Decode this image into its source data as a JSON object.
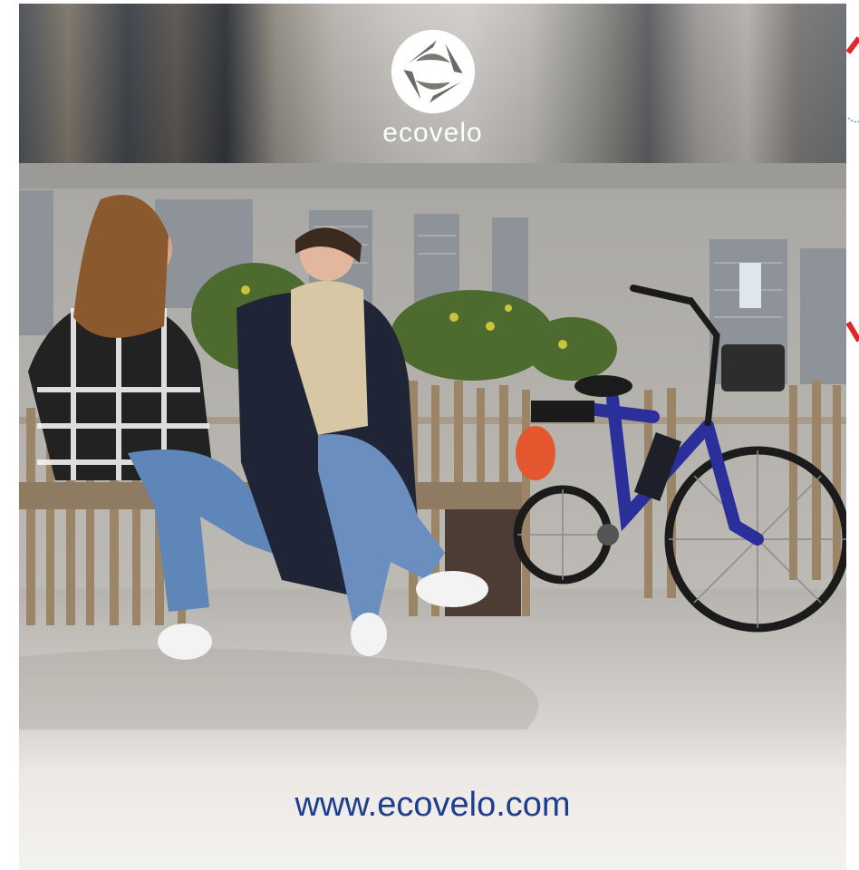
{
  "brand": {
    "name": "ecovelo",
    "website": "www.ecovelo.com"
  },
  "colors": {
    "link": "#1f3d8f",
    "bike_frame": "#2b2f9a",
    "accent_orange": "#e4572e",
    "edge_red": "#e0252b"
  },
  "icons": {
    "logo": "ecovelo-aperture-logo"
  }
}
